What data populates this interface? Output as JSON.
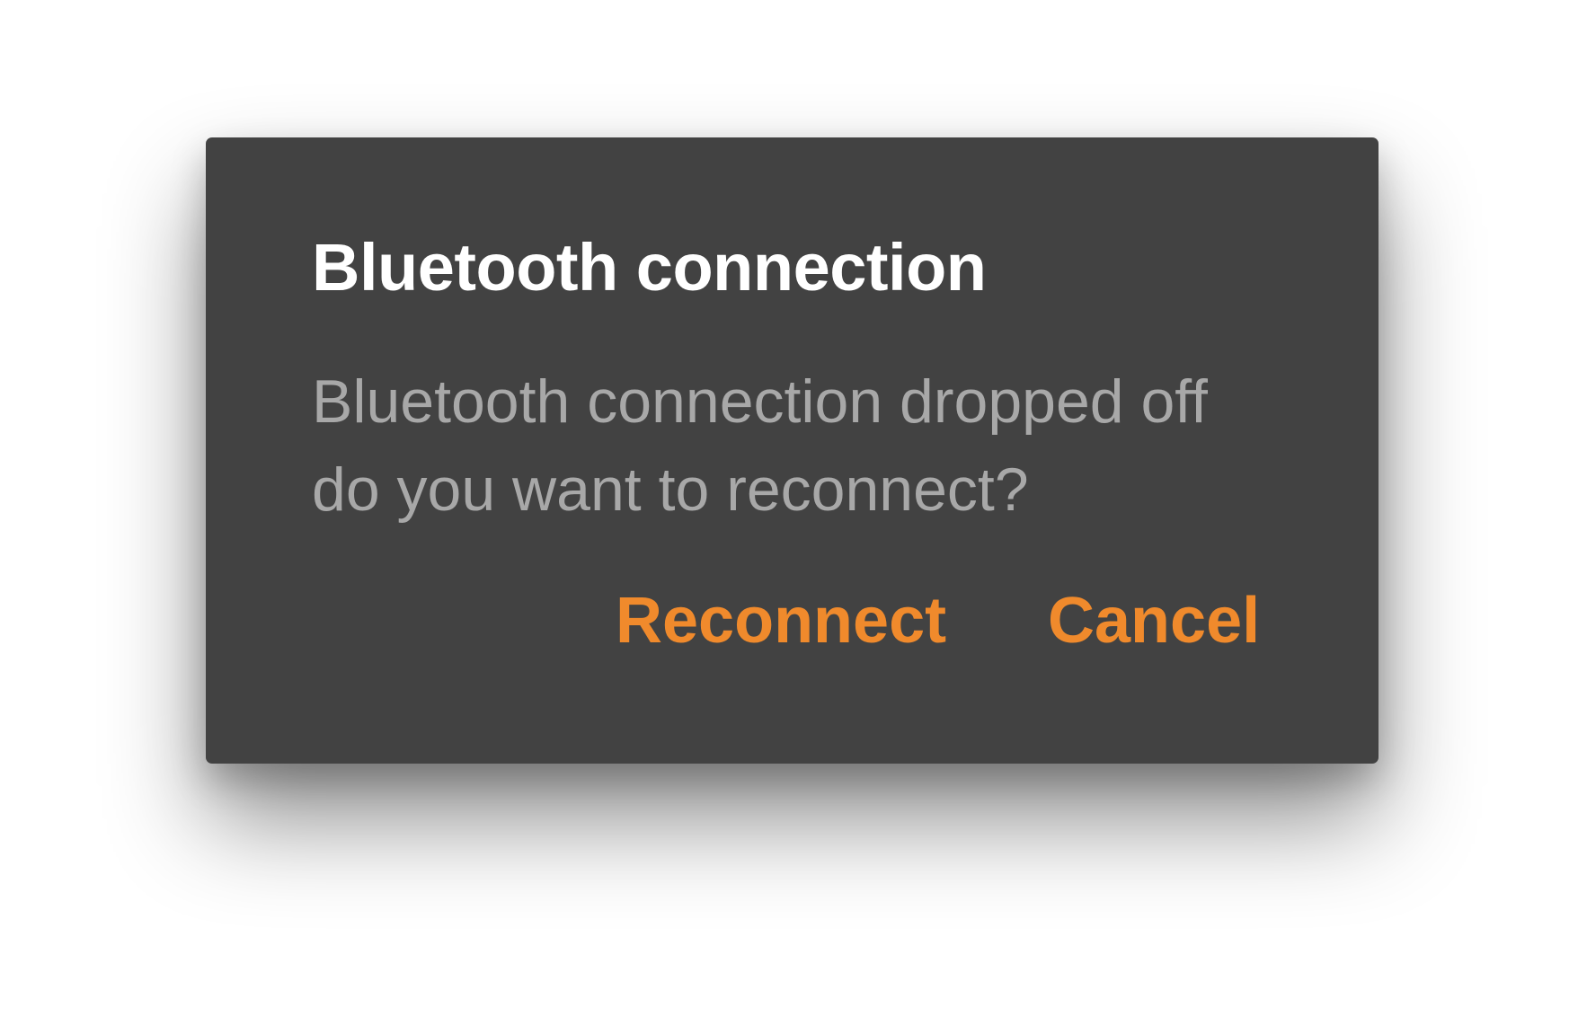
{
  "dialog": {
    "title": "Bluetooth connection",
    "message_lines": [
      "Bluetooth connection dropped off",
      "do you want to reconnect?"
    ],
    "actions": {
      "reconnect_label": "Reconnect",
      "cancel_label": "Cancel"
    }
  },
  "colors": {
    "dialog_background": "#424242",
    "title_text": "#ffffff",
    "message_text": "#a8a8a8",
    "accent": "#f08a2c",
    "page_background": "#ffffff"
  }
}
